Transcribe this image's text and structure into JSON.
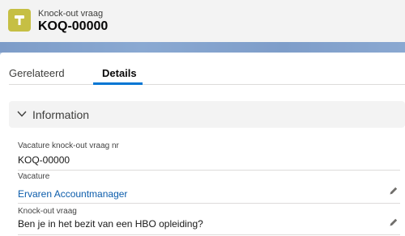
{
  "header": {
    "object_type": "Knock-out vraag",
    "record_name": "KOQ-00000",
    "icon": "hammer-icon",
    "icon_color": "#c6bf44"
  },
  "tabs": [
    {
      "label": "Gerelateerd",
      "active": false
    },
    {
      "label": "Details",
      "active": true
    }
  ],
  "section": {
    "title": "Information",
    "expanded": true
  },
  "fields": [
    {
      "label": "Vacature knock-out vraag nr",
      "value": "KOQ-00000",
      "editable": false
    },
    {
      "label": "Vacature",
      "value": "Ervaren Accountmanager",
      "is_link": true,
      "editable": true
    },
    {
      "label": "Knock-out vraag",
      "value": "Ben je in het bezit van een HBO opleiding?",
      "editable": true
    }
  ],
  "colors": {
    "accent": "#0176d3",
    "link": "#0b5cab",
    "band": "#7d9cc8"
  }
}
